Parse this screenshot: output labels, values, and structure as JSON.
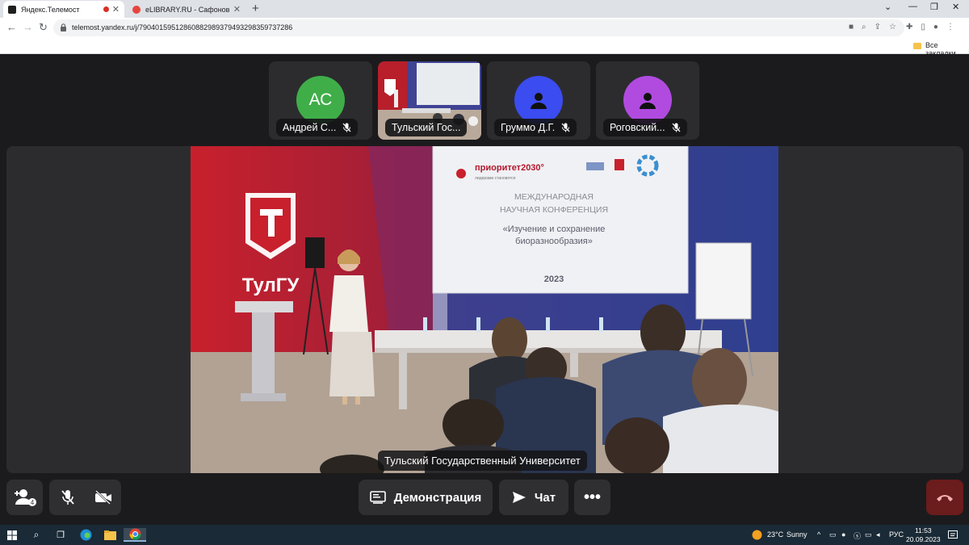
{
  "browser": {
    "tabs": [
      {
        "title": "Яндекс.Телемост",
        "active": true
      },
      {
        "title": "eLIBRARY.RU - Сафонов Андрей",
        "active": false
      }
    ],
    "url": "telemost.yandex.ru/j/79040159512860882989379493298359737286",
    "bookmarks_label": "Все закладки"
  },
  "participants": [
    {
      "initials": "АС",
      "name": "Андрей С...",
      "color": "#3fae49",
      "muted": true
    },
    {
      "initials": "",
      "name": "Тульский Гос...",
      "color": "",
      "muted": false
    },
    {
      "initials": "",
      "name": "Груммо Д.Г.",
      "color": "#3b4cf0",
      "muted": true
    },
    {
      "initials": "",
      "name": "Роговский...",
      "color": "#b14be0",
      "muted": true
    }
  ],
  "stage": {
    "speaker_caption": "Тульский Государственный Университет",
    "slide": {
      "brand": "приоритет2030°",
      "brand_sub": "лидерами становятся",
      "line1": "МЕЖДУНАРОДНАЯ",
      "line2": "НАУЧНАЯ КОНФЕРЕНЦИЯ",
      "line3": "«Изучение и сохранение",
      "line4": "биоразнообразия»",
      "year": "2023"
    },
    "wall_logo": "ТулГУ"
  },
  "controls": {
    "demo_label": "Демонстрация",
    "chat_label": "Чат"
  },
  "taskbar": {
    "weather_temp": "23°C",
    "weather_text": "Sunny",
    "lang": "РУС",
    "time": "11:53",
    "date": "20.09.2023"
  }
}
